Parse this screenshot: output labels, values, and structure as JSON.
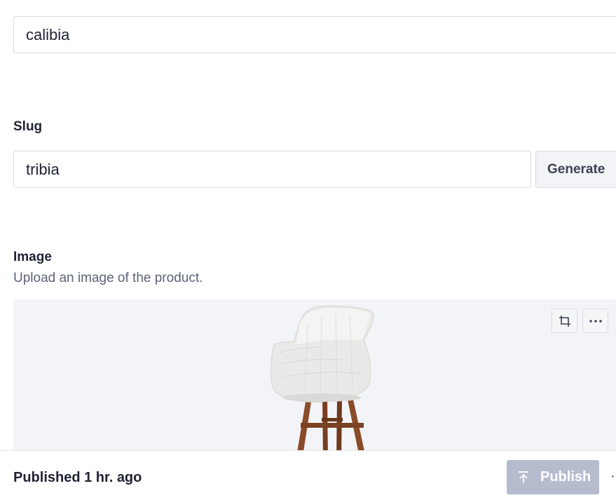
{
  "fields": {
    "title": {
      "value": "calibia"
    },
    "slug": {
      "label": "Slug",
      "value": "tribia",
      "generate_label": "Generate"
    },
    "image": {
      "label": "Image",
      "description": "Upload an image of the product.",
      "crop_icon": "crop-icon",
      "more_icon": "ellipsis-icon"
    }
  },
  "footer": {
    "status": "Published 1 hr. ago",
    "publish_label": "Publish",
    "publish_disabled": true,
    "publish_icon": "arrow-up-to-line-icon",
    "more_glyph": "·"
  },
  "colors": {
    "border": "#d8dbe3",
    "text": "#1f2333",
    "muted_text": "#5d6378",
    "image_bg": "#f3f4f7",
    "publish_disabled_bg": "#b6bcce"
  }
}
